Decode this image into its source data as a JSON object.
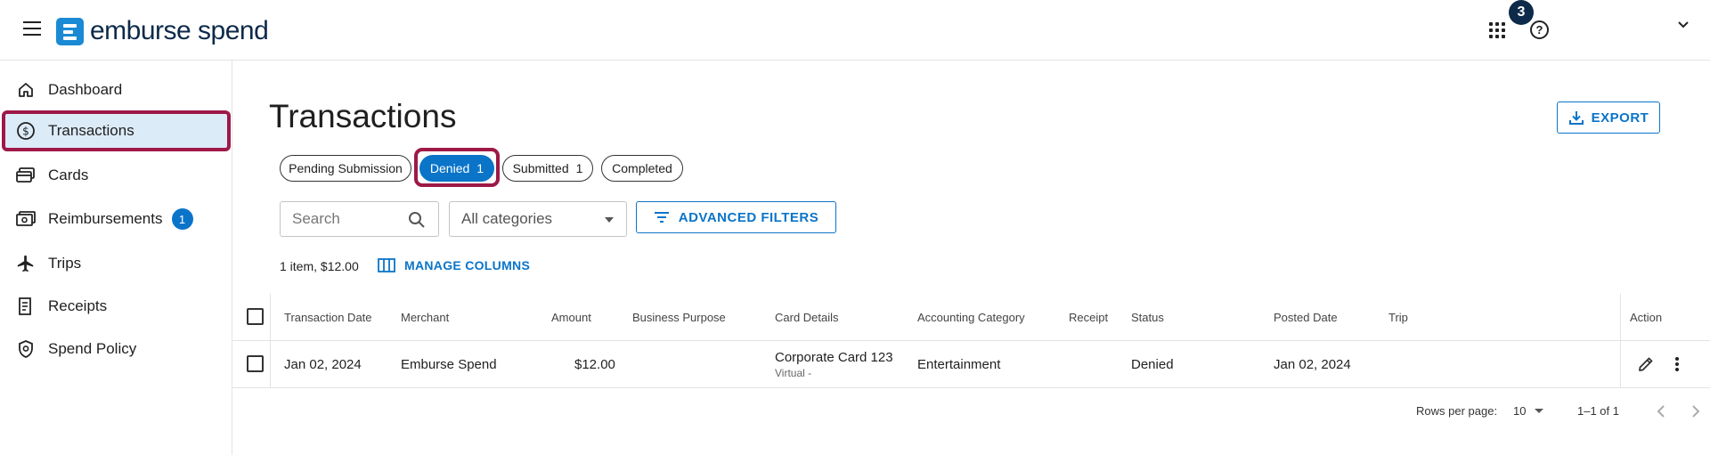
{
  "app": {
    "name": "emburse spend",
    "notification_count": "3",
    "help_glyph": "?"
  },
  "sidebar": {
    "items": [
      {
        "label": "Dashboard",
        "icon": "home-icon"
      },
      {
        "label": "Transactions",
        "icon": "dollar-circle-icon",
        "active": true
      },
      {
        "label": "Cards",
        "icon": "cards-icon"
      },
      {
        "label": "Reimbursements",
        "icon": "cash-icon",
        "badge": "1"
      },
      {
        "label": "Trips",
        "icon": "airplane-icon"
      },
      {
        "label": "Receipts",
        "icon": "receipt-icon"
      },
      {
        "label": "Spend Policy",
        "icon": "shield-icon"
      }
    ]
  },
  "page": {
    "title": "Transactions",
    "export_label": "EXPORT"
  },
  "tabs": [
    {
      "label": "Pending Submission",
      "count": ""
    },
    {
      "label": "Denied",
      "count": "1",
      "active": true
    },
    {
      "label": "Submitted",
      "count": "1"
    },
    {
      "label": "Completed",
      "count": ""
    }
  ],
  "filters": {
    "search_placeholder": "Search",
    "category_value": "All categories",
    "advanced_label": "ADVANCED FILTERS"
  },
  "summary": {
    "text": "1 item, $12.00",
    "manage_columns_label": "MANAGE COLUMNS"
  },
  "table": {
    "headers": {
      "transaction_date": "Transaction Date",
      "merchant": "Merchant",
      "amount": "Amount",
      "business_purpose": "Business Purpose",
      "card_details": "Card Details",
      "accounting_category": "Accounting Category",
      "receipt": "Receipt",
      "status": "Status",
      "posted_date": "Posted Date",
      "trip": "Trip",
      "action": "Action"
    },
    "rows": [
      {
        "transaction_date": "Jan 02, 2024",
        "merchant": "Emburse Spend",
        "amount": "$12.00",
        "business_purpose": "",
        "card_name": "Corporate Card 123",
        "card_type": "Virtual -",
        "accounting_category": "Entertainment",
        "receipt": "",
        "status": "Denied",
        "posted_date": "Jan 02, 2024",
        "trip": ""
      }
    ]
  },
  "pagination": {
    "rows_per_page_label": "Rows per page:",
    "rows_per_page_value": "10",
    "range": "1–1 of 1"
  },
  "colors": {
    "accent": "#0a74c9",
    "highlight": "#9e1848",
    "brand_dark": "#0d2a4a",
    "active_nav_bg": "#dcebf8"
  }
}
